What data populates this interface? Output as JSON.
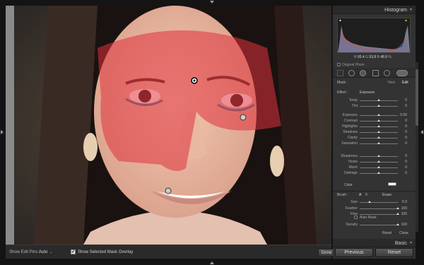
{
  "histogram_panel": {
    "title": "Histogram",
    "r_label": "R",
    "r_value": "60.4",
    "g_label": "G",
    "g_value": "53.8",
    "b_label": "B",
    "b_value": "48.9",
    "pct": "%",
    "original_photo": "Original Photo"
  },
  "mask": {
    "label": "Mask :",
    "new": "New",
    "edit": "Edit"
  },
  "effect": {
    "label": "Effect :",
    "value": "Exposure"
  },
  "sliders": [
    {
      "name": "Temp",
      "value": "0",
      "pos": 0.5
    },
    {
      "name": "Tint",
      "value": "0",
      "pos": 0.5
    },
    {
      "name": "Exposure",
      "value": "0.00",
      "pos": 0.5
    },
    {
      "name": "Contrast",
      "value": "0",
      "pos": 0.5
    },
    {
      "name": "Highlights",
      "value": "0",
      "pos": 0.5
    },
    {
      "name": "Shadows",
      "value": "0",
      "pos": 0.5
    },
    {
      "name": "Clarity",
      "value": "0",
      "pos": 0.5
    },
    {
      "name": "Saturation",
      "value": "0",
      "pos": 0.5
    },
    {
      "name": "Sharpness",
      "value": "0",
      "pos": 0.5
    },
    {
      "name": "Noise",
      "value": "0",
      "pos": 0.5
    },
    {
      "name": "Moiré",
      "value": "0",
      "pos": 0.5
    },
    {
      "name": "Defringe",
      "value": "0",
      "pos": 0.5
    }
  ],
  "color": {
    "label": "Color"
  },
  "brush": {
    "label": "Brush :",
    "a": "A",
    "b": "B",
    "erase": "Erase",
    "size": {
      "name": "Size",
      "value": "5.0",
      "pos": 0.25
    },
    "feather": {
      "name": "Feather",
      "value": "100",
      "pos": 1.0
    },
    "flow": {
      "name": "Flow",
      "value": "100",
      "pos": 1.0
    },
    "auto_mask": "Auto Mask",
    "density": {
      "name": "Density",
      "value": "100",
      "pos": 1.0
    }
  },
  "footer": {
    "reset": "Reset",
    "close": "Close"
  },
  "basic_panel": {
    "title": "Basic"
  },
  "buttons": {
    "previous": "Previous",
    "reset": "Reset"
  },
  "toolbar": {
    "show_edit_pins": "Show Edit Pins :",
    "pins_value": "Auto",
    "show_overlay": "Show Selected Mask Overlay",
    "overlay_checked": "✔",
    "done": "Done"
  },
  "icons": {
    "collapse": "triangle-down-icon",
    "panel_arrows": "triangle-icon"
  },
  "colors": {
    "mask_overlay": "#e0323c",
    "panel_bg": "#333333"
  }
}
